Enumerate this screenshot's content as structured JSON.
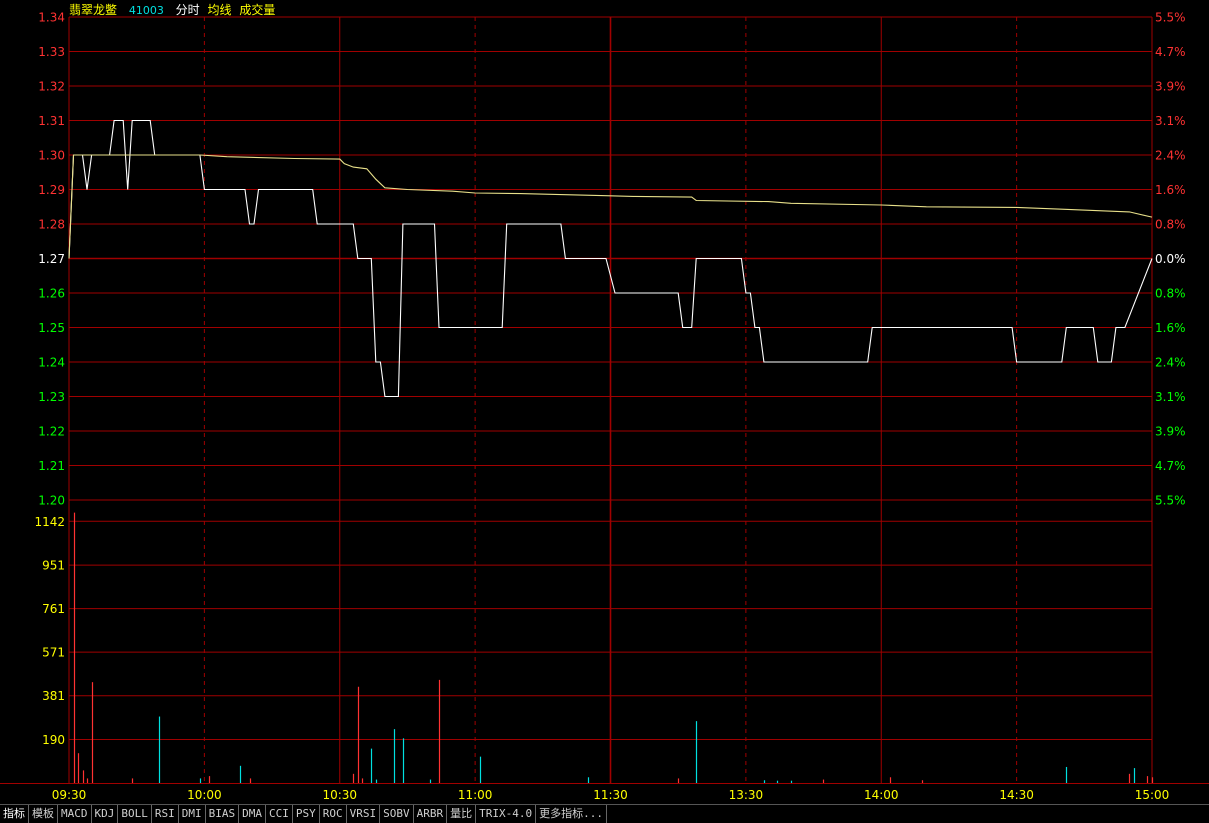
{
  "header": {
    "stock_name": "翡翠龙鳖",
    "stock_code": "41003",
    "labels": [
      "分时",
      "均线",
      "成交量"
    ]
  },
  "colors": {
    "background": "#000000",
    "grid": "#a00000",
    "price_line": "#ffffff",
    "avg_line": "#e8e08a",
    "up": "#ff3232",
    "down": "#00ff00",
    "flat": "#ffffff",
    "volume_up": "#ff3232",
    "volume_down": "#00e0e0",
    "volume_label": "#ffff00",
    "time_label": "#ffff00"
  },
  "tabs": [
    "指标",
    "模板",
    "MACD",
    "KDJ",
    "BOLL",
    "RSI",
    "DMI",
    "BIAS",
    "DMA",
    "CCI",
    "PSY",
    "ROC",
    "VRSI",
    "SOBV",
    "ARBR",
    "量比",
    "TRIX-4.0",
    "更多指标..."
  ],
  "chart_data": {
    "type": "line",
    "reference_price": 1.27,
    "price_axis": {
      "ylim": [
        1.2,
        1.34
      ],
      "ticks": [
        "1.34",
        "1.33",
        "1.32",
        "1.31",
        "1.30",
        "1.29",
        "1.28",
        "1.27",
        "1.26",
        "1.25",
        "1.24",
        "1.23",
        "1.22",
        "1.21",
        "1.20"
      ],
      "pct_ticks": [
        "5.5%",
        "4.7%",
        "3.9%",
        "3.1%",
        "2.4%",
        "1.6%",
        "0.8%",
        "0.0%",
        "0.8%",
        "1.6%",
        "2.4%",
        "3.1%",
        "3.9%",
        "4.7%",
        "5.5%"
      ]
    },
    "volume_axis": {
      "ylim": [
        0,
        1235
      ],
      "ticks": [
        "1142",
        "951",
        "761",
        "571",
        "381",
        "190"
      ]
    },
    "time_axis": {
      "sessions": [
        [
          "09:30",
          "11:30"
        ],
        [
          "13:00",
          "15:00"
        ]
      ],
      "labels": [
        "09:30",
        "10:00",
        "10:30",
        "11:00",
        "11:30",
        "13:30",
        "14:00",
        "14:30",
        "15:00"
      ]
    },
    "series": [
      {
        "type": "line",
        "points": [
          [
            "09:30",
            1.27
          ],
          [
            "09:31",
            1.3
          ],
          [
            "09:33",
            1.3
          ],
          [
            "09:34",
            1.29
          ],
          [
            "09:35",
            1.3
          ],
          [
            "09:39",
            1.3
          ],
          [
            "09:40",
            1.31
          ],
          [
            "09:42",
            1.31
          ],
          [
            "09:43",
            1.29
          ],
          [
            "09:44",
            1.31
          ],
          [
            "09:48",
            1.31
          ],
          [
            "09:49",
            1.3
          ],
          [
            "09:59",
            1.3
          ],
          [
            "10:00",
            1.29
          ],
          [
            "10:09",
            1.29
          ],
          [
            "10:10",
            1.28
          ],
          [
            "10:11",
            1.28
          ],
          [
            "10:12",
            1.29
          ],
          [
            "10:24",
            1.29
          ],
          [
            "10:25",
            1.28
          ],
          [
            "10:33",
            1.28
          ],
          [
            "10:34",
            1.27
          ],
          [
            "10:37",
            1.27
          ],
          [
            "10:38",
            1.24
          ],
          [
            "10:39",
            1.24
          ],
          [
            "10:40",
            1.23
          ],
          [
            "10:43",
            1.23
          ],
          [
            "10:44",
            1.28
          ],
          [
            "10:51",
            1.28
          ],
          [
            "10:52",
            1.25
          ],
          [
            "11:06",
            1.25
          ],
          [
            "11:07",
            1.28
          ],
          [
            "11:19",
            1.28
          ],
          [
            "11:20",
            1.27
          ],
          [
            "11:29",
            1.27
          ],
          [
            "13:01",
            1.26
          ],
          [
            "13:15",
            1.26
          ],
          [
            "13:16",
            1.25
          ],
          [
            "13:18",
            1.25
          ],
          [
            "13:19",
            1.27
          ],
          [
            "13:29",
            1.27
          ],
          [
            "13:30",
            1.26
          ],
          [
            "13:31",
            1.26
          ],
          [
            "13:32",
            1.25
          ],
          [
            "13:33",
            1.25
          ],
          [
            "13:34",
            1.24
          ],
          [
            "13:57",
            1.24
          ],
          [
            "13:58",
            1.25
          ],
          [
            "14:29",
            1.25
          ],
          [
            "14:30",
            1.24
          ],
          [
            "14:40",
            1.24
          ],
          [
            "14:41",
            1.25
          ],
          [
            "14:47",
            1.25
          ],
          [
            "14:48",
            1.24
          ],
          [
            "14:51",
            1.24
          ],
          [
            "14:52",
            1.25
          ],
          [
            "14:54",
            1.25
          ],
          [
            "15:00",
            1.27
          ]
        ]
      },
      {
        "type": "line",
        "points": [
          [
            "09:30",
            1.27
          ],
          [
            "09:31",
            1.3
          ],
          [
            "09:40",
            1.3
          ],
          [
            "09:59",
            1.3
          ],
          [
            "10:05",
            1.2995
          ],
          [
            "10:20",
            1.299
          ],
          [
            "10:30",
            1.2988
          ],
          [
            "10:31",
            1.2975
          ],
          [
            "10:33",
            1.2965
          ],
          [
            "10:36",
            1.296
          ],
          [
            "10:37",
            1.2945
          ],
          [
            "10:38",
            1.293
          ],
          [
            "10:40",
            1.2905
          ],
          [
            "10:45",
            1.29
          ],
          [
            "10:55",
            1.2895
          ],
          [
            "11:00",
            1.289
          ],
          [
            "11:10",
            1.2888
          ],
          [
            "11:20",
            1.2885
          ],
          [
            "11:29",
            1.2882
          ],
          [
            "13:05",
            1.288
          ],
          [
            "13:18",
            1.2878
          ],
          [
            "13:19",
            1.2868
          ],
          [
            "13:35",
            1.2865
          ],
          [
            "13:40",
            1.286
          ],
          [
            "14:00",
            1.2855
          ],
          [
            "14:10",
            1.285
          ],
          [
            "14:30",
            1.2848
          ],
          [
            "14:40",
            1.2843
          ],
          [
            "14:55",
            1.2835
          ],
          [
            "15:00",
            1.282
          ]
        ]
      }
    ],
    "volume": [
      [
        "09:31",
        1180,
        "up"
      ],
      [
        "09:32",
        130,
        "up"
      ],
      [
        "09:33",
        55,
        "up"
      ],
      [
        "09:34",
        20,
        "up"
      ],
      [
        "09:35",
        440,
        "up"
      ],
      [
        "09:44",
        20,
        "up"
      ],
      [
        "09:50",
        290,
        "down"
      ],
      [
        "09:59",
        20,
        "down"
      ],
      [
        "10:01",
        30,
        "up"
      ],
      [
        "10:08",
        75,
        "down"
      ],
      [
        "10:10",
        20,
        "up"
      ],
      [
        "10:33",
        40,
        "up"
      ],
      [
        "10:34",
        420,
        "up"
      ],
      [
        "10:35",
        20,
        "up"
      ],
      [
        "10:37",
        150,
        "down"
      ],
      [
        "10:38",
        15,
        "down"
      ],
      [
        "10:42",
        235,
        "down"
      ],
      [
        "10:44",
        195,
        "down"
      ],
      [
        "10:50",
        15,
        "down"
      ],
      [
        "10:52",
        450,
        "up"
      ],
      [
        "11:01",
        115,
        "down"
      ],
      [
        "11:25",
        25,
        "down"
      ],
      [
        "13:15",
        20,
        "up"
      ],
      [
        "13:19",
        270,
        "down"
      ],
      [
        "13:34",
        12,
        "down"
      ],
      [
        "13:37",
        10,
        "down"
      ],
      [
        "13:40",
        10,
        "down"
      ],
      [
        "13:47",
        15,
        "up"
      ],
      [
        "14:02",
        25,
        "up"
      ],
      [
        "14:09",
        12,
        "up"
      ],
      [
        "14:41",
        70,
        "down"
      ],
      [
        "14:55",
        40,
        "up"
      ],
      [
        "14:56",
        65,
        "down"
      ],
      [
        "14:59",
        30,
        "up"
      ],
      [
        "15:00",
        25,
        "up"
      ]
    ]
  }
}
